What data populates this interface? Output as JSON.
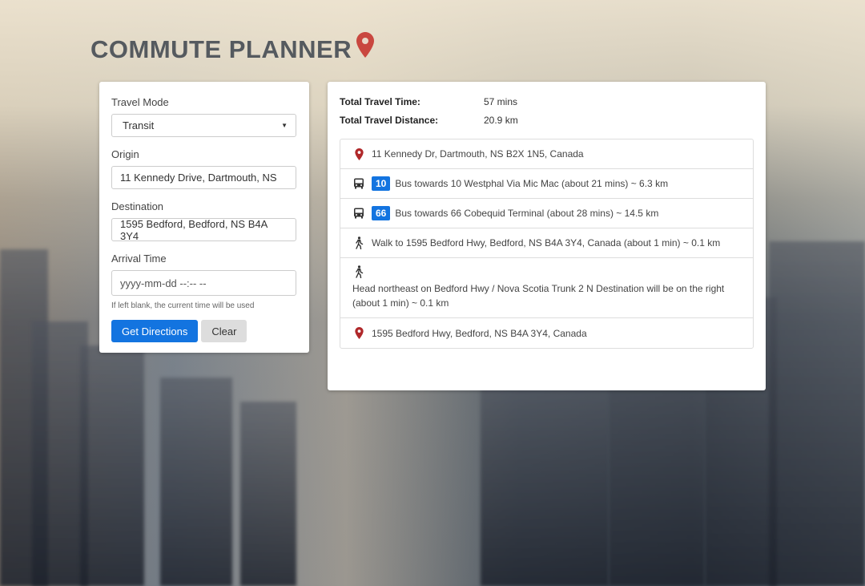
{
  "app": {
    "title": "COMMUTE PLANNER",
    "accent": "#1374e0",
    "pin_color": "#c0392b"
  },
  "form": {
    "travel_mode_label": "Travel Mode",
    "travel_mode_value": "Transit",
    "origin_label": "Origin",
    "origin_value": "11 Kennedy Drive, Dartmouth, NS",
    "destination_label": "Destination",
    "destination_value": "1595 Bedford, Bedford, NS B4A 3Y4",
    "arrival_label": "Arrival Time",
    "arrival_placeholder": "yyyy-mm-dd --:-- --",
    "arrival_hint": "If left blank, the current time will be used",
    "get_directions_label": "Get Directions",
    "clear_label": "Clear"
  },
  "results": {
    "time_label": "Total Travel Time:",
    "time_value": "57 mins",
    "distance_label": "Total Travel Distance:",
    "distance_value": "20.9 km",
    "steps": [
      {
        "icon": "map-pin-icon",
        "text": "11 Kennedy Dr, Dartmouth, NS B2X 1N5, Canada"
      },
      {
        "icon": "bus-icon",
        "route": "10",
        "text": "Bus towards 10 Westphal Via Mic Mac (about 21 mins) ~ 6.3 km"
      },
      {
        "icon": "bus-icon",
        "route": "66",
        "text": "Bus towards 66 Cobequid Terminal (about 28 mins) ~ 14.5 km"
      },
      {
        "icon": "walk-icon",
        "text": "Walk to 1595 Bedford Hwy, Bedford, NS B4A 3Y4, Canada (about 1 min) ~ 0.1 km"
      },
      {
        "icon": "walk-icon",
        "text": "Head northeast on Bedford Hwy / Nova Scotia Trunk 2 N Destination will be on the right (about 1 min) ~ 0.1 km"
      },
      {
        "icon": "map-pin-icon",
        "text": "1595 Bedford Hwy, Bedford, NS B4A 3Y4, Canada"
      }
    ]
  }
}
